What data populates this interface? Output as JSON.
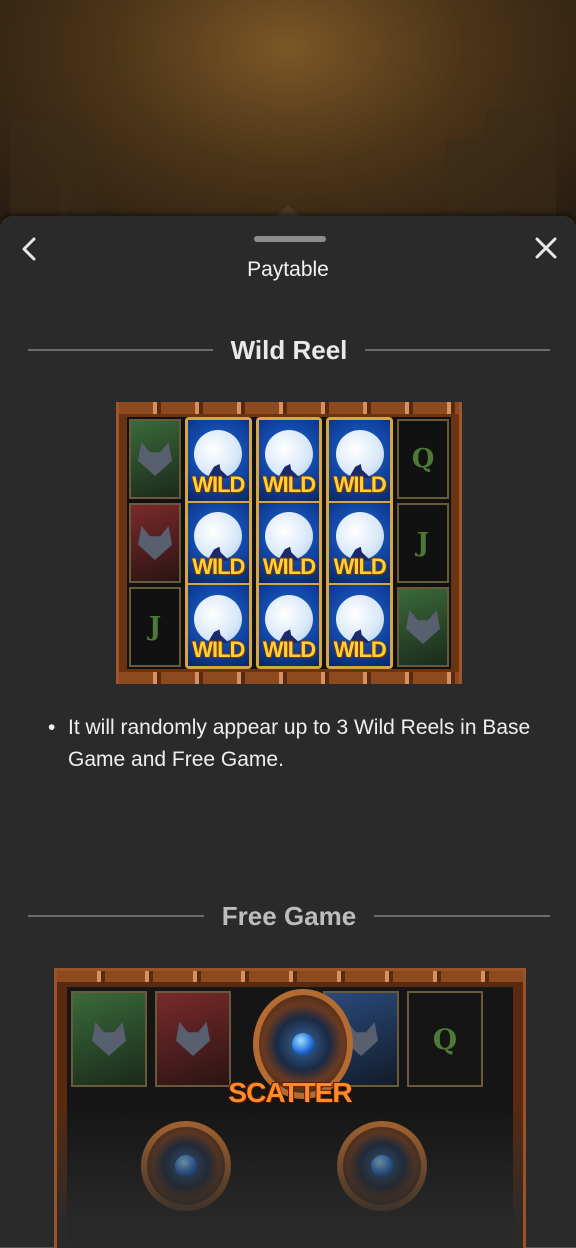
{
  "header": {
    "title": "Paytable",
    "back_icon": "chevron-left-icon",
    "close_icon": "close-icon"
  },
  "sections": [
    {
      "heading": "Wild Reel",
      "image_symbols": {
        "wild_label": "WILD",
        "side_letters": [
          "Q",
          "J",
          "J"
        ]
      },
      "bullets": [
        "It will randomly appear up to 3 Wild Reels in Base Game and Free Game."
      ]
    },
    {
      "heading": "Free Game",
      "image_symbols": {
        "scatter_label": "SCATTER",
        "side_letter": "Q"
      }
    }
  ],
  "colors": {
    "sheet_background": "#2a2a2a",
    "divider": "#6c6c6c",
    "wild_gold": "#ffd23a",
    "scatter_orange": "#ff8a2a"
  }
}
